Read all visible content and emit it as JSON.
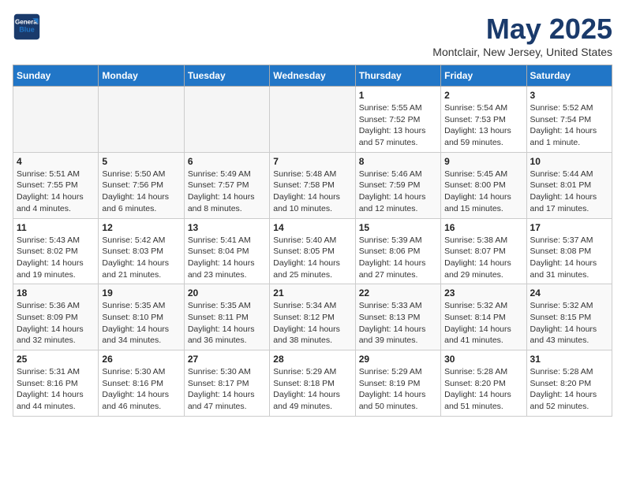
{
  "header": {
    "logo_line1": "General",
    "logo_line2": "Blue",
    "month_year": "May 2025",
    "location": "Montclair, New Jersey, United States"
  },
  "days_of_week": [
    "Sunday",
    "Monday",
    "Tuesday",
    "Wednesday",
    "Thursday",
    "Friday",
    "Saturday"
  ],
  "weeks": [
    [
      {
        "day": "",
        "info": ""
      },
      {
        "day": "",
        "info": ""
      },
      {
        "day": "",
        "info": ""
      },
      {
        "day": "",
        "info": ""
      },
      {
        "day": "1",
        "info": "Sunrise: 5:55 AM\nSunset: 7:52 PM\nDaylight: 13 hours\nand 57 minutes."
      },
      {
        "day": "2",
        "info": "Sunrise: 5:54 AM\nSunset: 7:53 PM\nDaylight: 13 hours\nand 59 minutes."
      },
      {
        "day": "3",
        "info": "Sunrise: 5:52 AM\nSunset: 7:54 PM\nDaylight: 14 hours\nand 1 minute."
      }
    ],
    [
      {
        "day": "4",
        "info": "Sunrise: 5:51 AM\nSunset: 7:55 PM\nDaylight: 14 hours\nand 4 minutes."
      },
      {
        "day": "5",
        "info": "Sunrise: 5:50 AM\nSunset: 7:56 PM\nDaylight: 14 hours\nand 6 minutes."
      },
      {
        "day": "6",
        "info": "Sunrise: 5:49 AM\nSunset: 7:57 PM\nDaylight: 14 hours\nand 8 minutes."
      },
      {
        "day": "7",
        "info": "Sunrise: 5:48 AM\nSunset: 7:58 PM\nDaylight: 14 hours\nand 10 minutes."
      },
      {
        "day": "8",
        "info": "Sunrise: 5:46 AM\nSunset: 7:59 PM\nDaylight: 14 hours\nand 12 minutes."
      },
      {
        "day": "9",
        "info": "Sunrise: 5:45 AM\nSunset: 8:00 PM\nDaylight: 14 hours\nand 15 minutes."
      },
      {
        "day": "10",
        "info": "Sunrise: 5:44 AM\nSunset: 8:01 PM\nDaylight: 14 hours\nand 17 minutes."
      }
    ],
    [
      {
        "day": "11",
        "info": "Sunrise: 5:43 AM\nSunset: 8:02 PM\nDaylight: 14 hours\nand 19 minutes."
      },
      {
        "day": "12",
        "info": "Sunrise: 5:42 AM\nSunset: 8:03 PM\nDaylight: 14 hours\nand 21 minutes."
      },
      {
        "day": "13",
        "info": "Sunrise: 5:41 AM\nSunset: 8:04 PM\nDaylight: 14 hours\nand 23 minutes."
      },
      {
        "day": "14",
        "info": "Sunrise: 5:40 AM\nSunset: 8:05 PM\nDaylight: 14 hours\nand 25 minutes."
      },
      {
        "day": "15",
        "info": "Sunrise: 5:39 AM\nSunset: 8:06 PM\nDaylight: 14 hours\nand 27 minutes."
      },
      {
        "day": "16",
        "info": "Sunrise: 5:38 AM\nSunset: 8:07 PM\nDaylight: 14 hours\nand 29 minutes."
      },
      {
        "day": "17",
        "info": "Sunrise: 5:37 AM\nSunset: 8:08 PM\nDaylight: 14 hours\nand 31 minutes."
      }
    ],
    [
      {
        "day": "18",
        "info": "Sunrise: 5:36 AM\nSunset: 8:09 PM\nDaylight: 14 hours\nand 32 minutes."
      },
      {
        "day": "19",
        "info": "Sunrise: 5:35 AM\nSunset: 8:10 PM\nDaylight: 14 hours\nand 34 minutes."
      },
      {
        "day": "20",
        "info": "Sunrise: 5:35 AM\nSunset: 8:11 PM\nDaylight: 14 hours\nand 36 minutes."
      },
      {
        "day": "21",
        "info": "Sunrise: 5:34 AM\nSunset: 8:12 PM\nDaylight: 14 hours\nand 38 minutes."
      },
      {
        "day": "22",
        "info": "Sunrise: 5:33 AM\nSunset: 8:13 PM\nDaylight: 14 hours\nand 39 minutes."
      },
      {
        "day": "23",
        "info": "Sunrise: 5:32 AM\nSunset: 8:14 PM\nDaylight: 14 hours\nand 41 minutes."
      },
      {
        "day": "24",
        "info": "Sunrise: 5:32 AM\nSunset: 8:15 PM\nDaylight: 14 hours\nand 43 minutes."
      }
    ],
    [
      {
        "day": "25",
        "info": "Sunrise: 5:31 AM\nSunset: 8:16 PM\nDaylight: 14 hours\nand 44 minutes."
      },
      {
        "day": "26",
        "info": "Sunrise: 5:30 AM\nSunset: 8:16 PM\nDaylight: 14 hours\nand 46 minutes."
      },
      {
        "day": "27",
        "info": "Sunrise: 5:30 AM\nSunset: 8:17 PM\nDaylight: 14 hours\nand 47 minutes."
      },
      {
        "day": "28",
        "info": "Sunrise: 5:29 AM\nSunset: 8:18 PM\nDaylight: 14 hours\nand 49 minutes."
      },
      {
        "day": "29",
        "info": "Sunrise: 5:29 AM\nSunset: 8:19 PM\nDaylight: 14 hours\nand 50 minutes."
      },
      {
        "day": "30",
        "info": "Sunrise: 5:28 AM\nSunset: 8:20 PM\nDaylight: 14 hours\nand 51 minutes."
      },
      {
        "day": "31",
        "info": "Sunrise: 5:28 AM\nSunset: 8:20 PM\nDaylight: 14 hours\nand 52 minutes."
      }
    ]
  ]
}
